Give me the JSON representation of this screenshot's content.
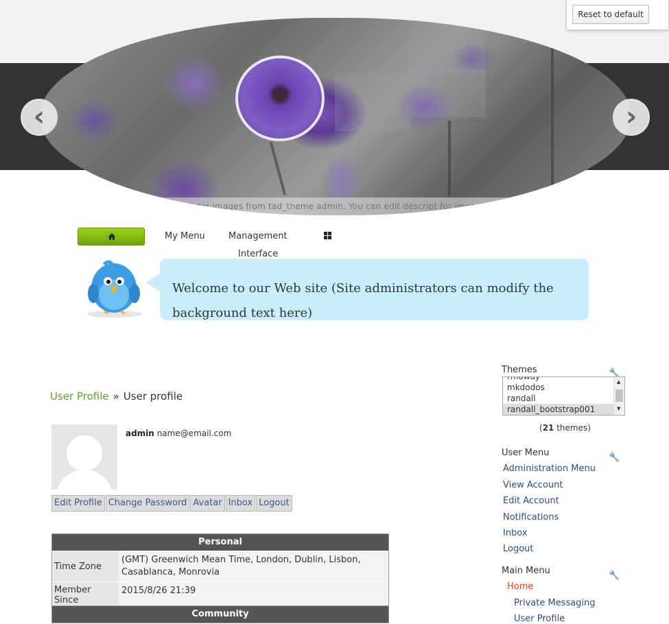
{
  "top": {
    "reset_label": "Reset to default"
  },
  "slider": {
    "caption": "You can upload slider images from tad_theme admin. You can edit descript for images with HTML tag.",
    "prev_glyph": "‹",
    "next_glyph": "›"
  },
  "nav": {
    "home_icon": "home-icon",
    "items": [
      "My Menu",
      "Management",
      "Interface"
    ],
    "grid_icon": "grid-icon",
    "accent": "#7fbf10"
  },
  "welcome": {
    "text": "Welcome to our Web site (Site administrators can modify the background text here)"
  },
  "breadcrumb": {
    "link": "User Profile",
    "separator": "»",
    "current": "User profile"
  },
  "user": {
    "name": "admin",
    "email": "name@email.com",
    "buttons": [
      "Edit Profile",
      "Change Password",
      "Avatar",
      "Inbox",
      "Logout"
    ]
  },
  "personal": {
    "header": "Personal",
    "rows": [
      {
        "label": "Time Zone",
        "value": "(GMT) Greenwich Mean Time, London, Dublin, Lisbon, Casablanca, Monrovia"
      },
      {
        "label": "Member Since",
        "value": "2015/8/26 21:39"
      }
    ]
  },
  "community": {
    "header": "Community"
  },
  "sidebar": {
    "themes": {
      "title": "Themes",
      "options": [
        "mkdodos",
        "randall",
        "randall_bootstrap001"
      ],
      "partial_option": "rmoway",
      "selected": "randall_bootstrap001",
      "count": "21",
      "count_suffix": "themes)",
      "count_prefix": "("
    },
    "user_menu": {
      "title": "User Menu",
      "items": [
        "Administration Menu",
        "View Account",
        "Edit Account",
        "Notifications",
        "Inbox",
        "Logout"
      ]
    },
    "main_menu": {
      "title": "Main Menu",
      "home": "Home",
      "items": [
        "Private Messaging",
        "User Profile"
      ]
    }
  }
}
